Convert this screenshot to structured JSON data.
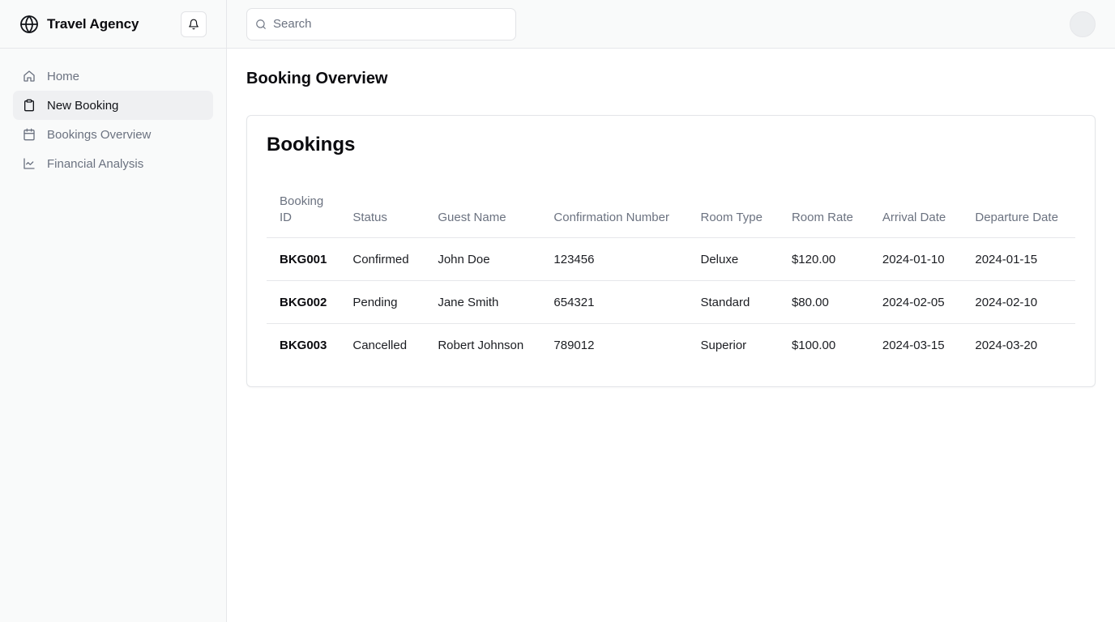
{
  "brand": {
    "name": "Travel Agency",
    "icon": "globe-icon"
  },
  "header": {
    "notification_icon": "bell-icon",
    "search": {
      "placeholder": "Search",
      "value": ""
    }
  },
  "sidebar": {
    "items": [
      {
        "label": "Home",
        "icon": "home-icon",
        "active": false
      },
      {
        "label": "New Booking",
        "icon": "clipboard-icon",
        "active": true
      },
      {
        "label": "Bookings Overview",
        "icon": "calendar-icon",
        "active": false
      },
      {
        "label": "Financial Analysis",
        "icon": "line-chart-icon",
        "active": false
      }
    ]
  },
  "page": {
    "title": "Booking Overview"
  },
  "card": {
    "title": "Bookings"
  },
  "table": {
    "headers": [
      "Booking ID",
      "Status",
      "Guest Name",
      "Confirmation Number",
      "Room Type",
      "Room Rate",
      "Arrival Date",
      "Departure Date"
    ],
    "rows": [
      [
        "BKG001",
        "Confirmed",
        "John Doe",
        "123456",
        "Deluxe",
        "$120.00",
        "2024-01-10",
        "2024-01-15"
      ],
      [
        "BKG002",
        "Pending",
        "Jane Smith",
        "654321",
        "Standard",
        "$80.00",
        "2024-02-05",
        "2024-02-10"
      ],
      [
        "BKG003",
        "Cancelled",
        "Robert Johnson",
        "789012",
        "Superior",
        "$100.00",
        "2024-03-15",
        "2024-03-20"
      ]
    ]
  },
  "colors": {
    "sidebar_bg": "#f9fafa",
    "active_bg": "#eff0f2",
    "muted_text": "#6b7280",
    "border": "#e6e7ea"
  }
}
